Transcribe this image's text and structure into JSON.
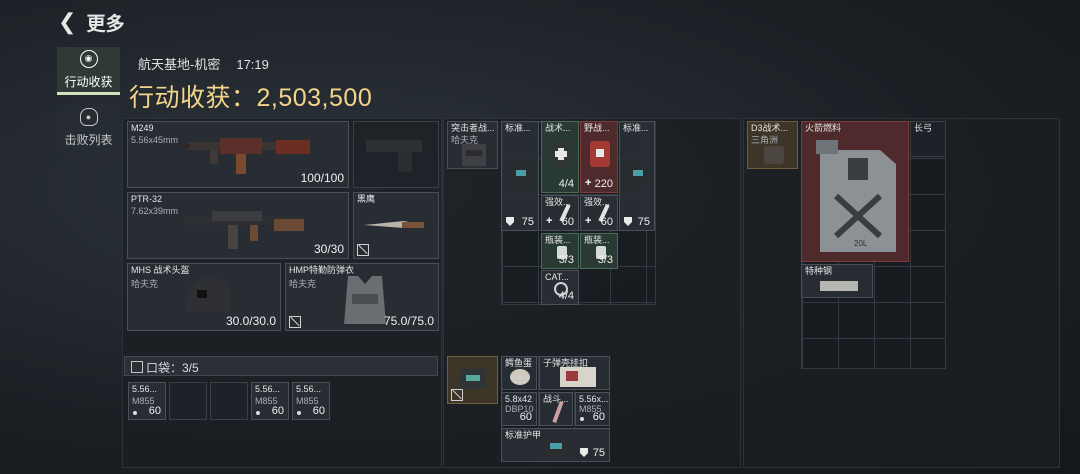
{
  "header": {
    "back_label": "更多"
  },
  "sidebar": {
    "tabs": [
      {
        "label": "行动收获",
        "active": true,
        "icon": "target-icon"
      },
      {
        "label": "击败列表",
        "active": false,
        "icon": "skull-icon"
      }
    ]
  },
  "map": {
    "name": "航天基地-机密",
    "time": "17:19"
  },
  "loot": {
    "title": "行动收获：2,503,500"
  },
  "equipment": {
    "primary": {
      "name": "M249",
      "ammo": "5.56x45mm",
      "value": "100/100"
    },
    "secondary": {
      "name": "PTR-32",
      "ammo": "7.62x39mm",
      "value": "30/30"
    },
    "pistol": {
      "name": ""
    },
    "melee": {
      "name": "黑鹰"
    },
    "helmet": {
      "name": "MHS 战术头盔",
      "brand": "哈夫克",
      "value": "30.0/30.0"
    },
    "armor": {
      "name": "HMP特勤防弹衣",
      "brand": "哈夫克",
      "value": "75.0/75.0"
    }
  },
  "pocket": {
    "label": "口袋：3/5",
    "items": [
      {
        "name": "5.56...",
        "sub": "M855",
        "value": "60"
      },
      {
        "name": "",
        "sub": "",
        "value": ""
      },
      {
        "name": "",
        "sub": "",
        "value": ""
      },
      {
        "name": "5.56...",
        "sub": "M855",
        "value": "60"
      },
      {
        "name": "5.56...",
        "sub": "M855",
        "value": "60"
      }
    ]
  },
  "chest_rig": {
    "name": "突击者战...",
    "brand": "哈夫克",
    "items": [
      {
        "name": "标准...",
        "value": "75"
      },
      {
        "name": "战术...",
        "value": "4/4"
      },
      {
        "name": "野战...",
        "value": "220"
      },
      {
        "name": "标准...",
        "value": "75"
      },
      {
        "name": "强效...",
        "value": "60"
      },
      {
        "name": "强效...",
        "value": "60"
      },
      {
        "name": "瓶装...",
        "value": "3/3"
      },
      {
        "name": "瓶装...",
        "value": "3/3"
      },
      {
        "name": "CAT...",
        "value": "4/4"
      }
    ]
  },
  "backpack": {
    "items": [
      {
        "name": "鳄鱼蛋",
        "value": ""
      },
      {
        "name": "子弹壳挂扣",
        "value": ""
      },
      {
        "name": "5.8x42",
        "sub": "DBP10",
        "value": "60"
      },
      {
        "name": "战斗...",
        "value": ""
      },
      {
        "name": "5.56x...",
        "sub": "M855",
        "value": "60"
      },
      {
        "name": "标准护甲",
        "value": "75"
      }
    ]
  },
  "safe_box": {
    "name": "D3战术...",
    "brand": "三角洲",
    "items": [
      {
        "name": "火箭燃料",
        "label_on_can": "20L"
      },
      {
        "name": "长弓"
      },
      {
        "name": "特种钢"
      }
    ]
  }
}
